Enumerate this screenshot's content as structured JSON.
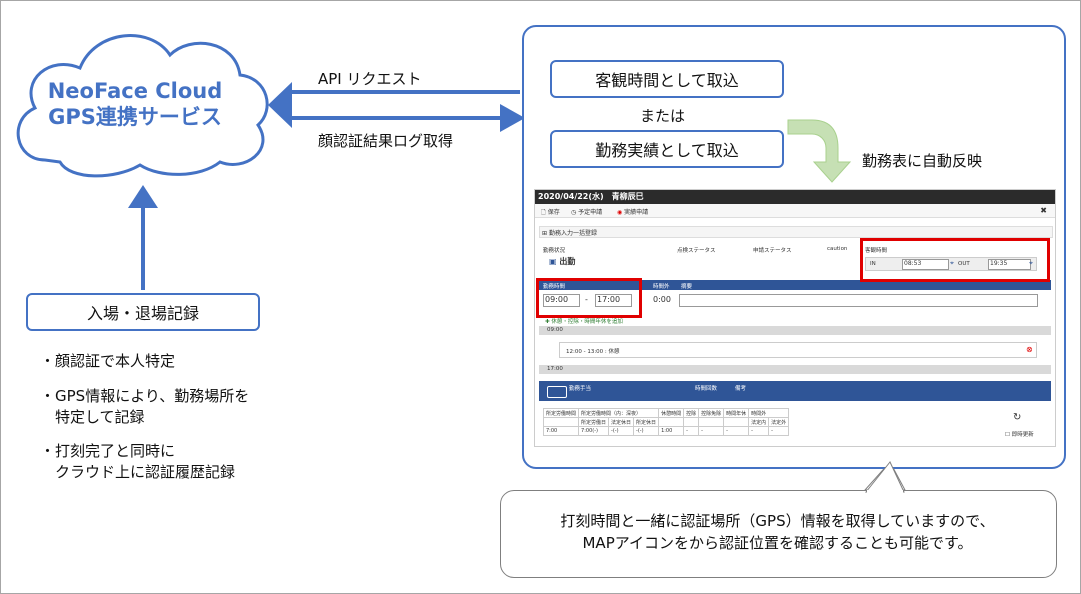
{
  "cloud": {
    "line1": "NeoFace Cloud",
    "line2": "GPS連携サービス"
  },
  "arrows": {
    "request_label": "API リクエスト",
    "log_label": "顔認証結果ログ取得",
    "auto_label": "勤務表に自動反映"
  },
  "options": {
    "objective": "客観時間として取込",
    "or": "または",
    "actual": "勤務実績として取込"
  },
  "entry_box": "入場・退場記録",
  "bullets": [
    {
      "l1": "・顔認証で本人特定",
      "l2": ""
    },
    {
      "l1": "・GPS情報により、勤務場所を",
      "l2": "特定して記録"
    },
    {
      "l1": "・打刻完了と同時に",
      "l2": "クラウド上に認証履歴記録"
    }
  ],
  "callout": {
    "line1": "打刻時間と一緒に認証場所（GPS）情報を取得していますので、",
    "line2": "MAPアイコンをから認証位置を確認することも可能です。"
  },
  "screen": {
    "title": "2020/04/22(水)　青柳辰巳",
    "toolbar": [
      "保存",
      "予定申請",
      "実績申請"
    ],
    "section": "勤務入力一括登録",
    "headers": {
      "status": "勤務状況",
      "check": "点検ステータス",
      "apply": "申請ステータス",
      "caution": "caution",
      "objective": "客観時間"
    },
    "status_value": "出勤",
    "in_label": "IN",
    "in_time": "08:53",
    "out_label": "OUT",
    "out_time": "19:35",
    "work_time_header": "勤務時間",
    "overtime_header": "時間外",
    "memo_header": "摘要",
    "start": "09:00",
    "dash": "-",
    "end": "17:00",
    "overtime": "0:00",
    "add_break": "休憩・控除・時間年休を追加",
    "t0900": "09:00",
    "break": "12:00 - 13:00 : 休憩",
    "t1700": "17:00",
    "allowance": "勤務手当",
    "allow_count": "時間回数",
    "allow_note": "備考",
    "table_h1": [
      "所定労働時間",
      "所定労働時間（内：深夜）",
      "",
      "",
      "休憩時間",
      "控除",
      "控除免除",
      "時間年休",
      "時間外",
      ""
    ],
    "table_h2": [
      "",
      "所定労働日",
      "法定休日",
      "所定休日",
      "",
      "",
      "",
      "",
      "法定内",
      "法定外"
    ],
    "table_v": [
      "7:00",
      "7:00(-)",
      "-(-)",
      "-(-)",
      "1:00",
      "-",
      "-",
      "-",
      "-",
      "-"
    ],
    "refresh": "即時更新"
  },
  "colors": {
    "accent": "#4472c4",
    "red": "#e00000"
  }
}
